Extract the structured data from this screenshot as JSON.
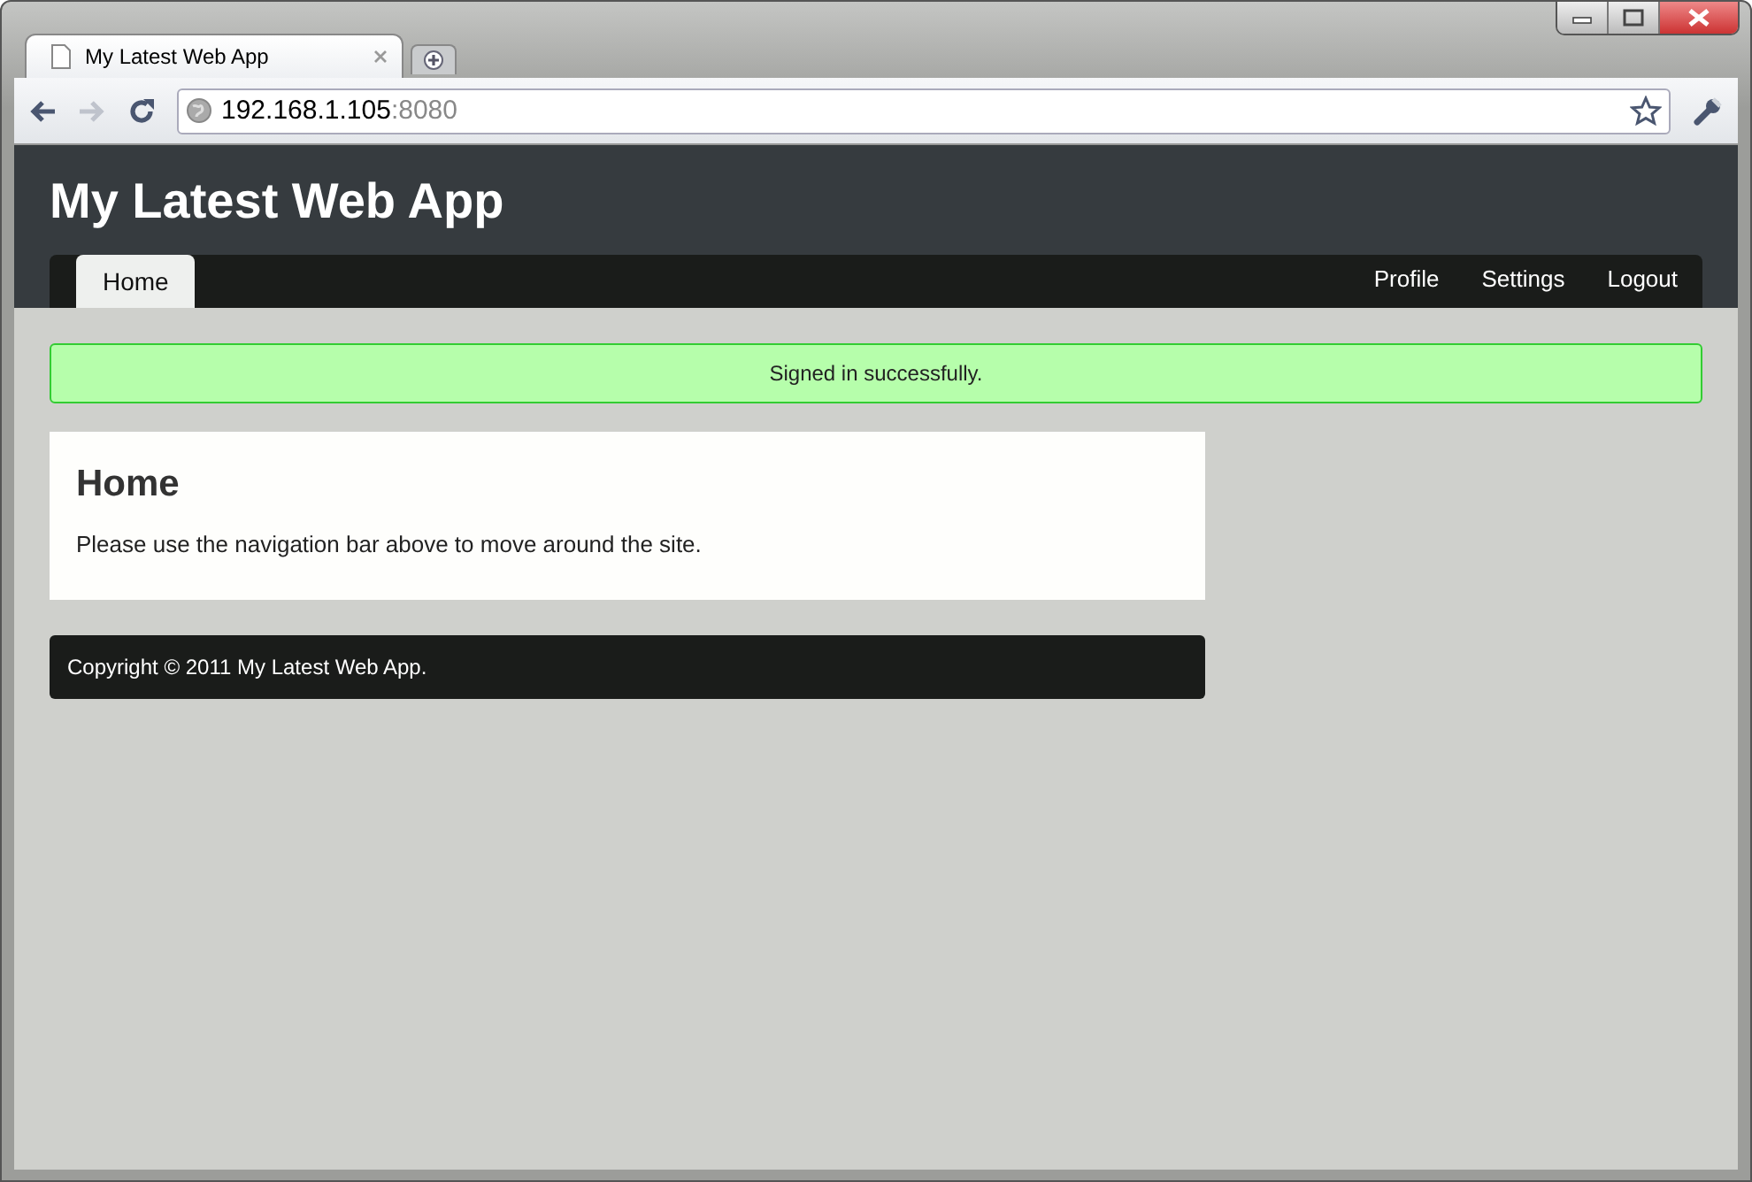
{
  "browser": {
    "tab_title": "My Latest Web App",
    "url_host": "192.168.1.105",
    "url_port": ":8080"
  },
  "site": {
    "title": "My Latest Web App",
    "nav_left": [
      {
        "label": "Home",
        "selected": true
      }
    ],
    "nav_right": [
      {
        "label": "Profile",
        "selected": false
      },
      {
        "label": "Settings",
        "selected": false
      },
      {
        "label": "Logout",
        "selected": false
      }
    ],
    "flash": "Signed in successfully.",
    "heading": "Home",
    "body": "Please use the navigation bar above to move around the site.",
    "footer": "Copyright © 2011 My Latest Web App."
  }
}
